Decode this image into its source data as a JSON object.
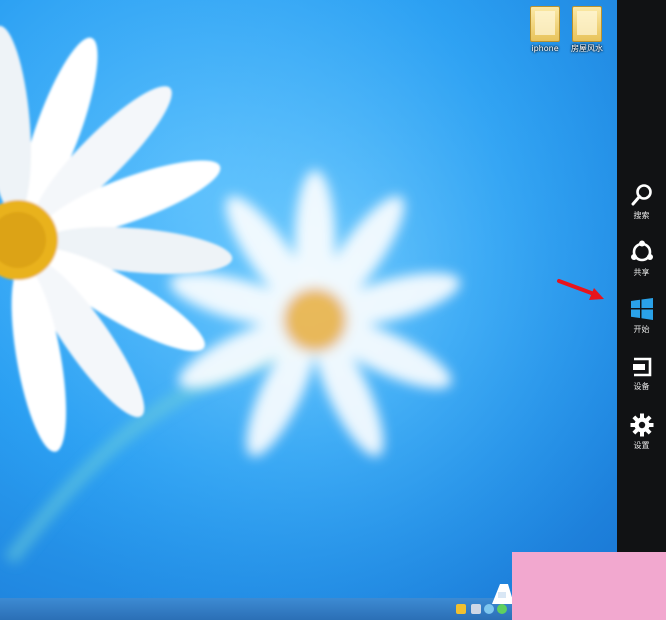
{
  "desktop": {
    "icons": [
      {
        "label": "iphone",
        "icon": "folder-icon"
      },
      {
        "label": "房屋风水",
        "icon": "folder-icon"
      }
    ]
  },
  "charms": {
    "items": [
      {
        "label": "搜索",
        "icon": "search-icon"
      },
      {
        "label": "共享",
        "icon": "share-icon"
      },
      {
        "label": "开始",
        "icon": "windows-start-icon"
      },
      {
        "label": "设备",
        "icon": "devices-icon"
      },
      {
        "label": "设置",
        "icon": "gear-icon"
      }
    ],
    "background": "#111214"
  },
  "colors": {
    "wallpaper_blue": "#2a9ff2",
    "start_blue": "#2aa1e8",
    "annotation_red": "#e8141c",
    "watermark_pink": "#f2a8cf"
  }
}
